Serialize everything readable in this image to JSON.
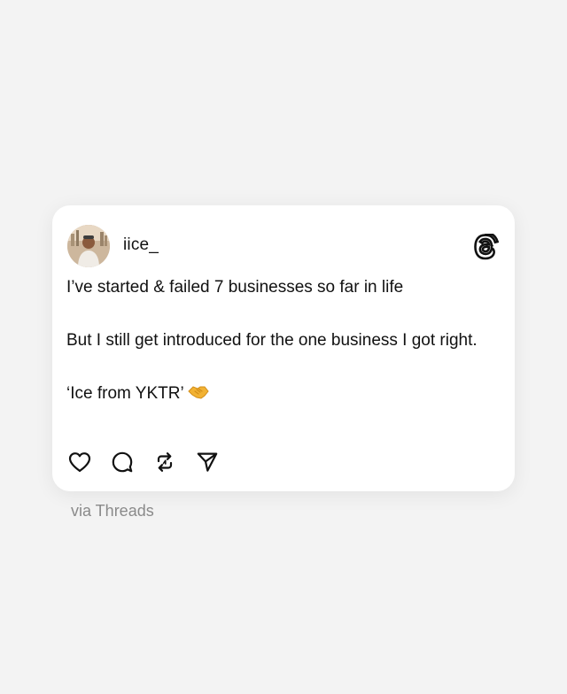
{
  "post": {
    "username": "iice_",
    "line1": "I’ve started & failed 7 businesses so far in life",
    "line2": "But I still get introduced for the one business I  got right.",
    "line3": "‘Ice from YKTR’",
    "emoji": "handshake-emoji"
  },
  "actions": [
    {
      "icon": "heart-icon"
    },
    {
      "icon": "comment-icon"
    },
    {
      "icon": "repost-icon"
    },
    {
      "icon": "share-icon"
    }
  ],
  "brand_icon": "threads-logo-icon",
  "footer": {
    "via": "via Threads"
  },
  "colors": {
    "background": "#f3f3f3",
    "card": "#ffffff",
    "text": "#111111",
    "muted": "#8a8a8a",
    "emoji": "#f2b233"
  }
}
